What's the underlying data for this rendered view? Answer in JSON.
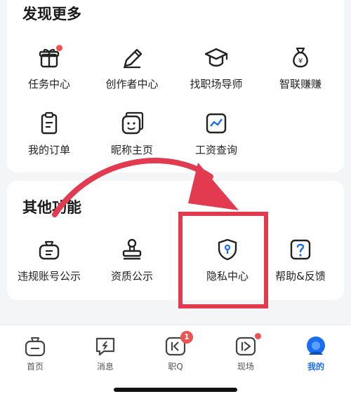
{
  "discover": {
    "title": "发现更多",
    "items": [
      {
        "label": "任务中心",
        "icon": "gift-icon"
      },
      {
        "label": "创作者中心",
        "icon": "pencil-icon"
      },
      {
        "label": "找职场导师",
        "icon": "graduation-cap-icon"
      },
      {
        "label": "智联赚赚",
        "icon": "money-bag-icon"
      },
      {
        "label": "我的订单",
        "icon": "clipboard-icon"
      },
      {
        "label": "昵称主页",
        "icon": "smiley-card-icon"
      },
      {
        "label": "工资查询",
        "icon": "line-chart-icon"
      }
    ]
  },
  "other": {
    "title": "其他功能",
    "items": [
      {
        "label": "违规账号公示",
        "icon": "notice-bag-icon"
      },
      {
        "label": "资质公示",
        "icon": "stamp-icon"
      },
      {
        "label": "隐私中心",
        "icon": "shield-icon"
      },
      {
        "label": "帮助&反馈",
        "icon": "question-icon"
      }
    ]
  },
  "tabbar": {
    "items": [
      {
        "label": "首页",
        "icon": "home-bag-icon"
      },
      {
        "label": "消息",
        "icon": "message-icon"
      },
      {
        "label": "职Q",
        "icon": "zhiq-icon",
        "badge": "1"
      },
      {
        "label": "现场",
        "icon": "live-icon"
      },
      {
        "label": "我的",
        "icon": "profile-avatar-icon"
      }
    ]
  },
  "colors": {
    "accent": "#1a6cf0",
    "annotation": "#e23a4f",
    "badge": "#f0524f"
  }
}
